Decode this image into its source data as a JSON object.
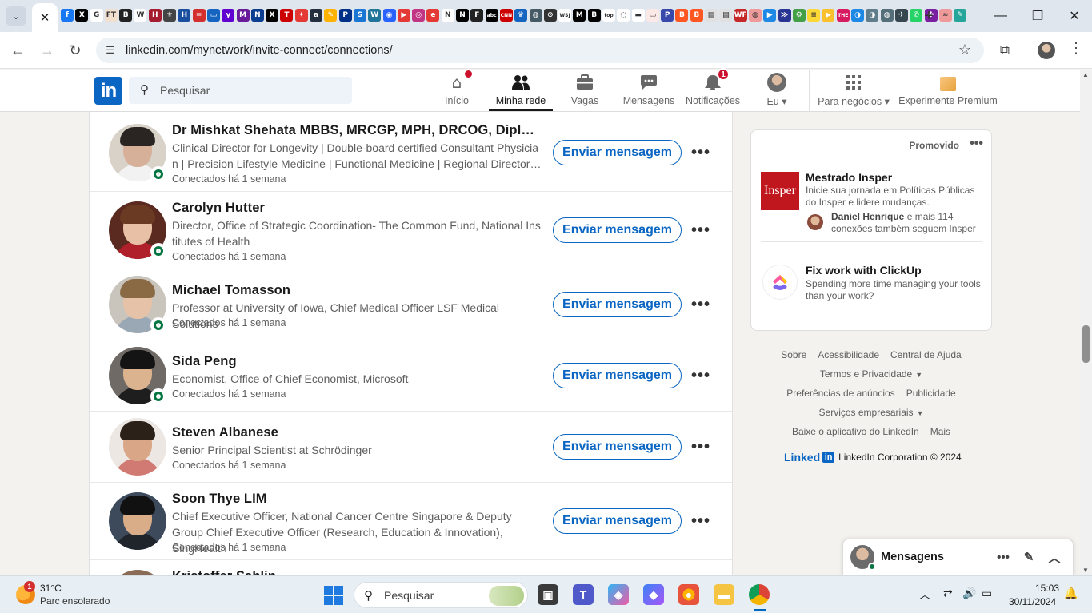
{
  "browser": {
    "close_tab_glyph": "✕",
    "new_tab_glyph": "+",
    "url": "linkedin.com/mynetwork/invite-connect/connections/",
    "pinned_tab_favicons": [
      {
        "name": "facebook",
        "color": "#1877f2",
        "glyph": "f"
      },
      {
        "name": "x",
        "color": "#000000",
        "glyph": "X"
      },
      {
        "name": "google",
        "color": "#ffffff",
        "glyph": "G"
      },
      {
        "name": "ft",
        "color": "#f2dfce",
        "glyph": "FT"
      },
      {
        "name": "bloomberg",
        "color": "#222222",
        "glyph": "B"
      },
      {
        "name": "wikipedia",
        "color": "#ffffff",
        "glyph": "W"
      },
      {
        "name": "harvard",
        "color": "#a51c30",
        "glyph": "H"
      },
      {
        "name": "site",
        "color": "#444444",
        "glyph": "⚜"
      },
      {
        "name": "site",
        "color": "#1a4fa0",
        "glyph": "H"
      },
      {
        "name": "site",
        "color": "#d32f2f",
        "glyph": "="
      },
      {
        "name": "site",
        "color": "#1565c0",
        "glyph": "▭"
      },
      {
        "name": "yahoo",
        "color": "#6001d2",
        "glyph": "y"
      },
      {
        "name": "site",
        "color": "#6a1b9a",
        "glyph": "M"
      },
      {
        "name": "site",
        "color": "#0b3d91",
        "glyph": "N"
      },
      {
        "name": "x",
        "color": "#000000",
        "glyph": "X"
      },
      {
        "name": "tesla",
        "color": "#cc0000",
        "glyph": "T"
      },
      {
        "name": "site",
        "color": "#e53935",
        "glyph": "✦"
      },
      {
        "name": "amazon",
        "color": "#232f3e",
        "glyph": "a"
      },
      {
        "name": "site",
        "color": "#ffb300",
        "glyph": "✎"
      },
      {
        "name": "paypal",
        "color": "#003087",
        "glyph": "P"
      },
      {
        "name": "site",
        "color": "#1976d2",
        "glyph": "S"
      },
      {
        "name": "wordpress",
        "color": "#21759b",
        "glyph": "W"
      },
      {
        "name": "site",
        "color": "#2962ff",
        "glyph": "◉"
      },
      {
        "name": "site",
        "color": "#e53935",
        "glyph": "▶"
      },
      {
        "name": "instagram",
        "color": "#c13584",
        "glyph": "◎"
      },
      {
        "name": "site",
        "color": "#e53935",
        "glyph": "e"
      },
      {
        "name": "site",
        "color": "#ffffff",
        "glyph": "N"
      },
      {
        "name": "netflix",
        "color": "#000000",
        "glyph": "N"
      },
      {
        "name": "site",
        "color": "#222222",
        "glyph": "F"
      },
      {
        "name": "abc",
        "color": "#000000",
        "glyph": "abc"
      },
      {
        "name": "cnn",
        "color": "#cc0000",
        "glyph": "CNN"
      },
      {
        "name": "site",
        "color": "#1565c0",
        "glyph": "♛"
      },
      {
        "name": "site",
        "color": "#455a64",
        "glyph": "◍"
      },
      {
        "name": "site",
        "color": "#333333",
        "glyph": "⊙"
      },
      {
        "name": "wsj",
        "color": "#ffffff",
        "glyph": "WSJ"
      },
      {
        "name": "site",
        "color": "#000000",
        "glyph": "M"
      },
      {
        "name": "site",
        "color": "#000000",
        "glyph": "B"
      },
      {
        "name": "site",
        "color": "#ffffff",
        "glyph": "top"
      },
      {
        "name": "site",
        "color": "#ffffff",
        "glyph": "◌"
      },
      {
        "name": "site",
        "color": "#ffffff",
        "glyph": "▬"
      },
      {
        "name": "site",
        "color": "#fbe9e7",
        "glyph": "▭"
      },
      {
        "name": "site",
        "color": "#3949ab",
        "glyph": "P"
      },
      {
        "name": "blogger",
        "color": "#ff5722",
        "glyph": "B"
      },
      {
        "name": "blogger",
        "color": "#ff5722",
        "glyph": "B"
      },
      {
        "name": "site",
        "color": "#e0e0e0",
        "glyph": "▤"
      },
      {
        "name": "site",
        "color": "#e0e0e0",
        "glyph": "▤"
      },
      {
        "name": "site",
        "color": "#c62828",
        "glyph": "WF"
      },
      {
        "name": "site",
        "color": "#ef9a9a",
        "glyph": "◍"
      },
      {
        "name": "site",
        "color": "#1e88e5",
        "glyph": "▶"
      },
      {
        "name": "site",
        "color": "#283593",
        "glyph": "≫"
      },
      {
        "name": "site",
        "color": "#43a047",
        "glyph": "⚙"
      },
      {
        "name": "site",
        "color": "#fdd835",
        "glyph": "≡"
      },
      {
        "name": "site",
        "color": "#fbc02d",
        "glyph": "▶"
      },
      {
        "name": "site",
        "color": "#d81b60",
        "glyph": "THE"
      },
      {
        "name": "site",
        "color": "#1e88e5",
        "glyph": "◑"
      },
      {
        "name": "site",
        "color": "#607d8b",
        "glyph": "◑"
      },
      {
        "name": "site",
        "color": "#546e7a",
        "glyph": "◍"
      },
      {
        "name": "site",
        "color": "#37474f",
        "glyph": "✈"
      },
      {
        "name": "whatsapp",
        "color": "#25d366",
        "glyph": "✆"
      },
      {
        "name": "site",
        "color": "#7b1fa2",
        "glyph": "✤"
      },
      {
        "name": "site",
        "color": "#ef9a9a",
        "glyph": "≈"
      },
      {
        "name": "site",
        "color": "#26a69a",
        "glyph": "✎"
      }
    ]
  },
  "linkedin": {
    "search_placeholder": "Pesquisar",
    "nav": [
      {
        "label": "Início",
        "icon": "home-icon",
        "glyph": "⌂",
        "badge": "",
        "active": false
      },
      {
        "label": "Minha rede",
        "icon": "network-icon",
        "glyph": "👥",
        "badge": "",
        "active": true
      },
      {
        "label": "Vagas",
        "icon": "briefcase-icon",
        "glyph": "💼",
        "badge": "",
        "active": false
      },
      {
        "label": "Mensagens",
        "icon": "messaging-icon",
        "glyph": "💬",
        "badge": "",
        "active": false
      },
      {
        "label": "Notificações",
        "icon": "bell-icon",
        "glyph": "🔔",
        "badge": "1",
        "active": false
      }
    ],
    "me_label": "Eu",
    "business_label": "Para negócios",
    "premium_label": "Experimente Premium"
  },
  "connections": [
    {
      "name": "Dr Mishkat Shehata MBBS, MRCGP, MPH, DRCOG, DipIBLM, A...",
      "headline": "Clinical Director for Longevity | Double-board certified Consultant Physician | Precision Lifestyle Medicine | Functional Medicine | Regional Director f...",
      "connected": "Conectados há 1 semana",
      "online": true
    },
    {
      "name": "Carolyn Hutter",
      "headline": "Director, Office of Strategic Coordination- The Common Fund, National Institutes of Health",
      "connected": "Conectados há 1 semana",
      "online": true
    },
    {
      "name": "Michael Tomasson",
      "headline": "Professor at University of Iowa, Chief Medical Officer LSF Medical Solutions",
      "connected": "Conectados há 1 semana",
      "online": true
    },
    {
      "name": "Sida Peng",
      "headline": "Economist, Office of Chief Economist, Microsoft",
      "connected": "Conectados há 1 semana",
      "online": true
    },
    {
      "name": "Steven Albanese",
      "headline": "Senior Principal Scientist at Schrödinger",
      "connected": "Conectados há 1 semana",
      "online": false
    },
    {
      "name": "Soon Thye LIM",
      "headline": "Chief Executive Officer, National Cancer Centre Singapore & Deputy Group Chief Executive Officer (Research, Education & Innovation), SingHealth",
      "connected": "Conectados há 1 semana",
      "online": false
    },
    {
      "name": "Kristoffer Sahlin",
      "headline": "",
      "connected": "",
      "online": false
    }
  ],
  "message_button_label": "Enviar mensagem",
  "more_glyph": "•••",
  "ads": {
    "promoted_label": "Promovido",
    "insper": {
      "logo_text": "Insper",
      "title": "Mestrado Insper",
      "description": "Inicie sua jornada em Políticas Públicas do Insper e lidere mudanças.",
      "social_name": "Daniel Henrique",
      "social_rest": "e mais 114 conexões também seguem Insper"
    },
    "clickup": {
      "title": "Fix work with ClickUp",
      "description": "Spending more time managing your tools than your work?"
    }
  },
  "footer": {
    "row1": [
      "Sobre",
      "Acessibilidade",
      "Central de Ajuda"
    ],
    "row2": "Termos e Privacidade",
    "row3": [
      "Preferências de anúncios",
      "Publicidade"
    ],
    "row4": "Serviços empresariais",
    "row5": [
      "Baixe o aplicativo do LinkedIn",
      "Mais"
    ],
    "brand_word": "Linked",
    "brand_in": "in",
    "copyright": "LinkedIn Corporation © 2024"
  },
  "messaging": {
    "title": "Mensagens"
  },
  "taskbar": {
    "weather_temp": "31°C",
    "weather_desc": "Parc ensolarado",
    "weather_badge": "1",
    "search_text": "Pesquisar",
    "time": "15:03",
    "date": "30/11/2024"
  },
  "colors": {
    "linkedin_blue": "#0a66c2",
    "online_green": "#057642",
    "badge_red": "#cb112d",
    "insper_red": "#c0161d"
  }
}
